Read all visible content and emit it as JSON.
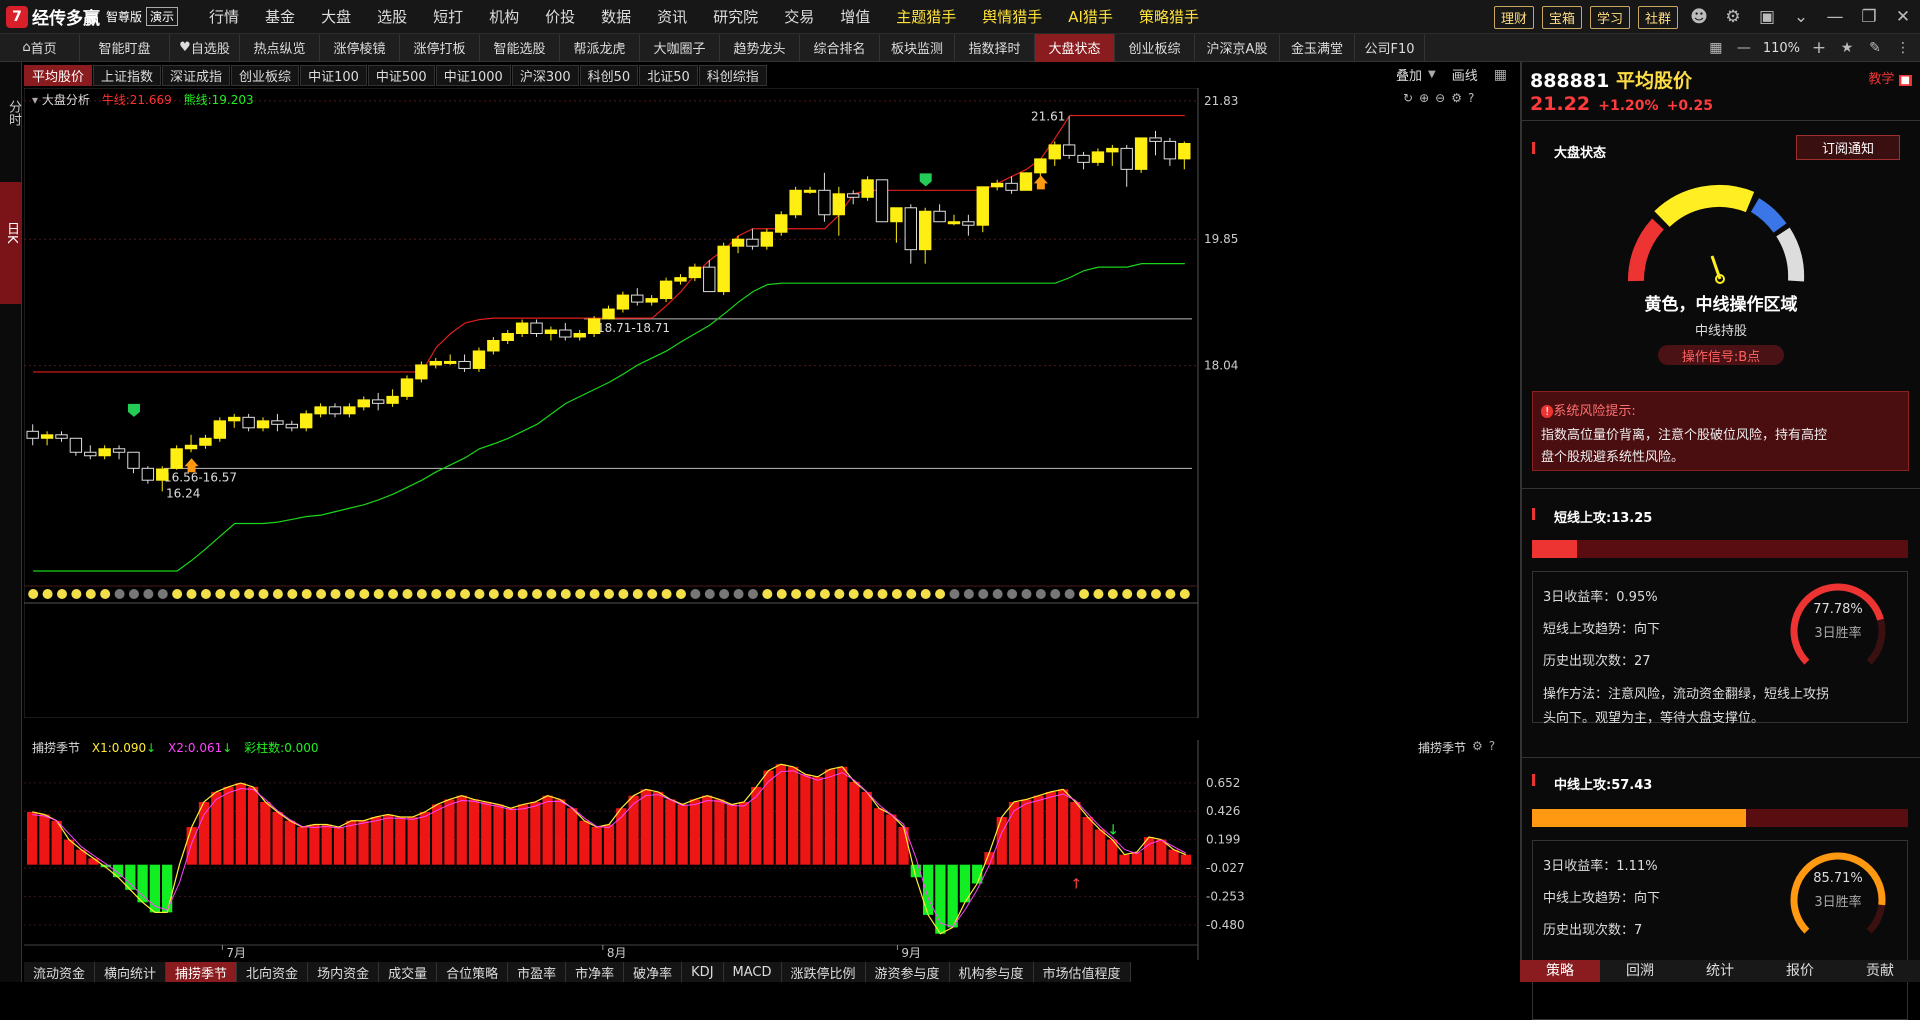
{
  "app": {
    "logo_mark": "7",
    "name": "经传多赢",
    "edition": "智尊版",
    "demo": "演示"
  },
  "menu1": [
    "行情",
    "基金",
    "大盘",
    "选股",
    "短打",
    "机构",
    "价投",
    "数据",
    "资讯",
    "研究院",
    "交易",
    "增值",
    "主题猎手",
    "舆情猎手",
    "AI猎手",
    "策略猎手"
  ],
  "menu1_dots": [
    7,
    9
  ],
  "menu1_hl": [
    12,
    13,
    14,
    15
  ],
  "top_pills": [
    "理财",
    "宝箱",
    "学习",
    "社群"
  ],
  "tabs2": [
    "首页",
    "智能盯盘",
    "自选股",
    "热点纵览",
    "涨停棱镜",
    "涨停打板",
    "智能选股",
    "帮派龙虎",
    "大咖圈子",
    "趋势龙头",
    "综合排名",
    "板块监测",
    "指数择时",
    "大盘状态",
    "创业板综",
    "沪深京A股",
    "金玉满堂",
    "公司F10"
  ],
  "tabs2_active": 13,
  "zoom": "110%",
  "left_strip": {
    "a": "分时",
    "b": "日K"
  },
  "tabs3": [
    "平均股价",
    "上证指数",
    "深证成指",
    "创业板综",
    "中证100",
    "中证500",
    "中证1000",
    "沪深300",
    "科创50",
    "北证50",
    "科创综指"
  ],
  "tabs3_active": 0,
  "overlay_label": "叠加",
  "draw_label": "画线",
  "main": {
    "name": "大盘分析",
    "ma_bull": "牛线:21.669",
    "ma_bear": "熊线:19.203"
  },
  "labels": {
    "a": "16.56-16.57",
    "b": "16.24",
    "c": "18.71-18.71",
    "d": "21.61"
  },
  "sub": {
    "name": "捕捞季节",
    "x1": "X1:0.090",
    "x2": "X2:0.061",
    "cnt": "彩柱数:0.000",
    "right": "捕捞季节"
  },
  "months": [
    "7月",
    "8月",
    "9月"
  ],
  "bottom_tabs": [
    "流动资金",
    "横向统计",
    "捕捞季节",
    "北向资金",
    "场内资金",
    "成交量",
    "合位策略",
    "市盈率",
    "市净率",
    "破净率",
    "KDJ",
    "MACD",
    "涨跌停比例",
    "游资参与度",
    "机构参与度",
    "市场估值程度"
  ],
  "bottom_active": 2,
  "right": {
    "code": "888881",
    "name": "平均股价",
    "price": "21.22",
    "chg_pct": "+1.20%",
    "chg": "+0.25",
    "tag": "教学",
    "status_title": "大盘状态",
    "subscribe": "订阅通知",
    "zone": "黄色，中线操作区域",
    "hold": "中线持股",
    "signal": "操作信号:B点",
    "risk_title": "系统风险提示:",
    "risk_text1": "指数高位量价背离，注意个股破位风险，持有高控",
    "risk_text2": "盘个股规避系统性风险。",
    "s1": {
      "title": "短线上攻:13.25",
      "fill": 0.12,
      "ret": "3日收益率：0.95%",
      "trend": "短线上攻趋势：向下",
      "count": "历史出现次数：27",
      "rate": "77.78%",
      "rate_val": 0.7778,
      "rate_lbl": "3日胜率",
      "method1": "操作方法：注意风险，流动资金翻绿，短线上攻拐",
      "method2": "头向下。观望为主，等待大盘支撑位。"
    },
    "s2": {
      "title": "中线上攻:57.43",
      "fill": 0.57,
      "ret": "3日收益率：1.11%",
      "trend": "中线上攻趋势：向下",
      "count": "历史出现次数：7",
      "rate": "85.71%",
      "rate_val": 0.8571,
      "rate_lbl": "3日胜率"
    },
    "tabs": [
      "策略",
      "回溯",
      "统计",
      "报价",
      "贡献"
    ]
  },
  "chart_data": {
    "type": "candlestick",
    "yaxis_ticks": [
      "21.83",
      "19.85",
      "18.04"
    ],
    "sub_ticks": [
      "0.652",
      "0.426",
      "0.199",
      "-0.027",
      "-0.253",
      "-0.480"
    ],
    "ohlc": [
      [
        17.1,
        17.2,
        16.9,
        17.0
      ],
      [
        17.0,
        17.1,
        16.9,
        17.05
      ],
      [
        17.05,
        17.1,
        16.95,
        17.0
      ],
      [
        17.0,
        17.0,
        16.75,
        16.8
      ],
      [
        16.8,
        16.9,
        16.7,
        16.75
      ],
      [
        16.75,
        16.9,
        16.7,
        16.85
      ],
      [
        16.85,
        16.9,
        16.7,
        16.8
      ],
      [
        16.8,
        16.8,
        16.5,
        16.57
      ],
      [
        16.57,
        16.6,
        16.35,
        16.4
      ],
      [
        16.4,
        16.6,
        16.24,
        16.56
      ],
      [
        16.57,
        16.9,
        16.55,
        16.85
      ],
      [
        16.85,
        17.05,
        16.8,
        16.9
      ],
      [
        16.9,
        17.05,
        16.85,
        17.0
      ],
      [
        17.0,
        17.3,
        16.95,
        17.25
      ],
      [
        17.25,
        17.35,
        17.15,
        17.3
      ],
      [
        17.3,
        17.35,
        17.1,
        17.15
      ],
      [
        17.15,
        17.3,
        17.1,
        17.25
      ],
      [
        17.25,
        17.35,
        17.1,
        17.2
      ],
      [
        17.2,
        17.25,
        17.1,
        17.15
      ],
      [
        17.15,
        17.4,
        17.1,
        17.35
      ],
      [
        17.35,
        17.5,
        17.3,
        17.45
      ],
      [
        17.45,
        17.5,
        17.3,
        17.35
      ],
      [
        17.35,
        17.5,
        17.3,
        17.45
      ],
      [
        17.45,
        17.6,
        17.4,
        17.55
      ],
      [
        17.55,
        17.65,
        17.4,
        17.5
      ],
      [
        17.5,
        17.7,
        17.45,
        17.6
      ],
      [
        17.6,
        17.9,
        17.55,
        17.85
      ],
      [
        17.85,
        18.1,
        17.8,
        18.05
      ],
      [
        18.05,
        18.15,
        18.0,
        18.1
      ],
      [
        18.1,
        18.2,
        18.05,
        18.1
      ],
      [
        18.1,
        18.2,
        17.95,
        18.0
      ],
      [
        18.0,
        18.3,
        17.95,
        18.25
      ],
      [
        18.25,
        18.45,
        18.2,
        18.4
      ],
      [
        18.4,
        18.55,
        18.35,
        18.5
      ],
      [
        18.5,
        18.7,
        18.45,
        18.65
      ],
      [
        18.65,
        18.7,
        18.45,
        18.5
      ],
      [
        18.5,
        18.6,
        18.4,
        18.55
      ],
      [
        18.55,
        18.65,
        18.4,
        18.45
      ],
      [
        18.45,
        18.55,
        18.4,
        18.5
      ],
      [
        18.5,
        18.75,
        18.45,
        18.71
      ],
      [
        18.71,
        18.9,
        18.7,
        18.85
      ],
      [
        18.85,
        19.1,
        18.8,
        19.05
      ],
      [
        19.05,
        19.15,
        18.9,
        18.95
      ],
      [
        18.95,
        19.05,
        18.9,
        19.0
      ],
      [
        19.0,
        19.3,
        18.95,
        19.25
      ],
      [
        19.25,
        19.35,
        19.2,
        19.3
      ],
      [
        19.3,
        19.5,
        19.25,
        19.45
      ],
      [
        19.45,
        19.55,
        19.1,
        19.1
      ],
      [
        19.1,
        19.8,
        19.05,
        19.75
      ],
      [
        19.75,
        19.9,
        19.65,
        19.85
      ],
      [
        19.85,
        20.0,
        19.7,
        19.75
      ],
      [
        19.75,
        20.0,
        19.7,
        19.95
      ],
      [
        19.95,
        20.25,
        19.9,
        20.2
      ],
      [
        20.2,
        20.6,
        20.15,
        20.55
      ],
      [
        20.55,
        20.6,
        20.5,
        20.55
      ],
      [
        20.55,
        20.8,
        20.1,
        20.2
      ],
      [
        20.2,
        20.6,
        19.9,
        20.5
      ],
      [
        20.5,
        20.55,
        20.35,
        20.45
      ],
      [
        20.45,
        20.75,
        20.4,
        20.7
      ],
      [
        20.7,
        20.7,
        20.1,
        20.1
      ],
      [
        20.1,
        20.3,
        19.8,
        20.3
      ],
      [
        20.3,
        20.35,
        19.5,
        19.7
      ],
      [
        19.7,
        20.3,
        19.5,
        20.25
      ],
      [
        20.25,
        20.35,
        20.1,
        20.1
      ],
      [
        20.1,
        20.2,
        20.05,
        20.1
      ],
      [
        20.1,
        20.2,
        19.9,
        20.05
      ],
      [
        20.05,
        20.6,
        19.95,
        20.6
      ],
      [
        20.6,
        20.7,
        20.55,
        20.65
      ],
      [
        20.65,
        20.75,
        20.5,
        20.55
      ],
      [
        20.55,
        20.8,
        20.55,
        20.8
      ],
      [
        20.8,
        21.0,
        20.75,
        21.0
      ],
      [
        21.0,
        21.25,
        20.9,
        21.2
      ],
      [
        21.2,
        21.61,
        21.0,
        21.05
      ],
      [
        21.05,
        21.1,
        20.85,
        20.95
      ],
      [
        20.95,
        21.15,
        20.9,
        21.1
      ],
      [
        21.1,
        21.2,
        20.9,
        21.15
      ],
      [
        21.15,
        21.2,
        20.6,
        20.85
      ],
      [
        20.85,
        21.3,
        20.8,
        21.3
      ],
      [
        21.3,
        21.4,
        21.05,
        21.25
      ],
      [
        21.25,
        21.3,
        20.9,
        21.0
      ],
      [
        21.0,
        21.25,
        20.85,
        21.22
      ]
    ],
    "bull_line": [
      17.95,
      17.95,
      17.95,
      17.95,
      17.95,
      17.95,
      17.95,
      17.95,
      17.95,
      17.95,
      17.95,
      17.95,
      17.95,
      17.95,
      17.95,
      17.95,
      17.95,
      17.95,
      17.95,
      17.95,
      17.95,
      17.95,
      17.95,
      17.95,
      17.95,
      17.95,
      17.95,
      17.95,
      18.3,
      18.5,
      18.65,
      18.7,
      18.72,
      18.72,
      18.72,
      18.72,
      18.72,
      18.72,
      18.72,
      18.72,
      18.72,
      18.72,
      18.72,
      18.72,
      18.9,
      19.1,
      19.35,
      19.55,
      19.7,
      19.9,
      20.0,
      20.0,
      20.0,
      20.0,
      20.0,
      20.0,
      20.2,
      20.5,
      20.55,
      20.55,
      20.55,
      20.55,
      20.55,
      20.55,
      20.55,
      20.55,
      20.55,
      20.65,
      20.75,
      20.85,
      21.0,
      21.3,
      21.62,
      21.62,
      21.62,
      21.62,
      21.62,
      21.62,
      21.62,
      21.62,
      21.62
    ],
    "bear_line": [
      15.1,
      15.1,
      15.1,
      15.1,
      15.1,
      15.1,
      15.1,
      15.1,
      15.1,
      15.1,
      15.1,
      15.25,
      15.42,
      15.6,
      15.78,
      15.78,
      15.78,
      15.8,
      15.84,
      15.88,
      15.9,
      15.95,
      16.0,
      16.05,
      16.12,
      16.2,
      16.3,
      16.4,
      16.52,
      16.62,
      16.72,
      16.85,
      16.92,
      17.0,
      17.1,
      17.2,
      17.35,
      17.5,
      17.6,
      17.7,
      17.8,
      17.92,
      18.05,
      18.15,
      18.25,
      18.38,
      18.5,
      18.62,
      18.78,
      18.95,
      19.1,
      19.2,
      19.22,
      19.22,
      19.22,
      19.22,
      19.22,
      19.22,
      19.22,
      19.22,
      19.22,
      19.22,
      19.22,
      19.22,
      19.22,
      19.22,
      19.22,
      19.22,
      19.22,
      19.22,
      19.22,
      19.22,
      19.3,
      19.4,
      19.45,
      19.45,
      19.45,
      19.5,
      19.5,
      19.5,
      19.5
    ],
    "sub_bars": [
      0.42,
      0.4,
      0.35,
      0.2,
      0.12,
      0.05,
      -0.02,
      -0.1,
      -0.2,
      -0.3,
      -0.38,
      -0.38,
      0.0,
      0.3,
      0.5,
      0.58,
      0.62,
      0.65,
      0.62,
      0.5,
      0.42,
      0.35,
      0.3,
      0.32,
      0.32,
      0.3,
      0.35,
      0.35,
      0.38,
      0.4,
      0.38,
      0.38,
      0.42,
      0.48,
      0.52,
      0.55,
      0.52,
      0.5,
      0.48,
      0.45,
      0.48,
      0.5,
      0.55,
      0.52,
      0.45,
      0.35,
      0.3,
      0.32,
      0.45,
      0.55,
      0.6,
      0.58,
      0.52,
      0.48,
      0.52,
      0.55,
      0.52,
      0.48,
      0.5,
      0.62,
      0.75,
      0.8,
      0.78,
      0.72,
      0.7,
      0.76,
      0.78,
      0.66,
      0.58,
      0.45,
      0.4,
      0.3,
      -0.1,
      -0.4,
      -0.55,
      -0.5,
      -0.3,
      -0.15,
      0.1,
      0.38,
      0.5,
      0.52,
      0.55,
      0.58,
      0.6,
      0.5,
      0.38,
      0.28,
      0.2,
      0.08,
      0.1,
      0.22,
      0.2,
      0.12,
      0.08
    ],
    "sub_dot_gray": [
      6,
      7,
      8,
      9,
      46,
      47,
      48,
      49,
      50,
      64,
      65,
      66,
      67,
      68,
      69,
      70,
      71,
      72
    ]
  }
}
